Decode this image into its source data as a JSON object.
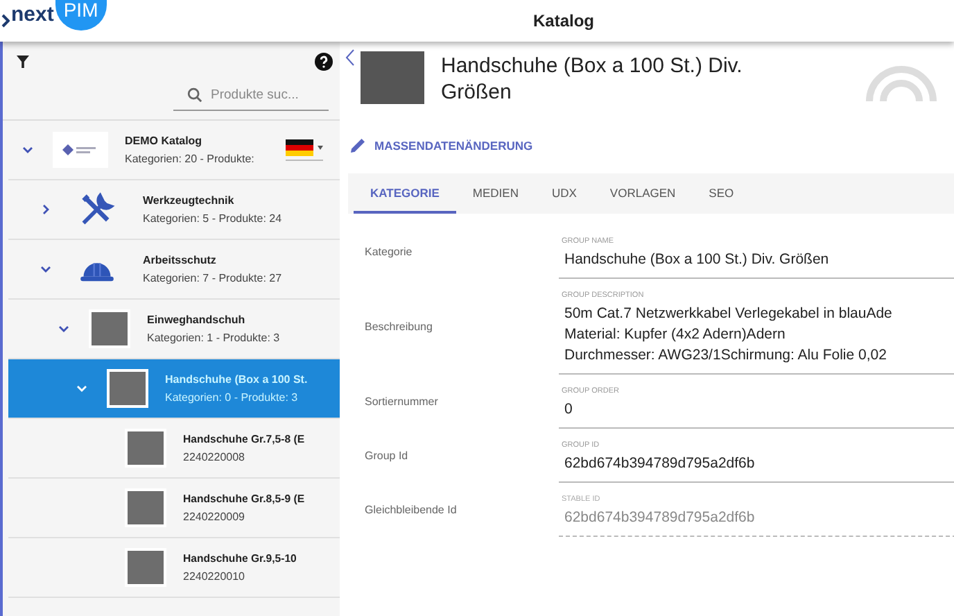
{
  "header": {
    "logo": {
      "prefix": "next",
      "suffix": "PIM"
    },
    "title": "Katalog"
  },
  "sidebar": {
    "search": {
      "placeholder": "Produkte suc..."
    },
    "tree": [
      {
        "kind": "catalog",
        "title": "DEMO Katalog",
        "subtitle": "Kategorien: 20 - Produkte:",
        "expanded": true,
        "selected": false,
        "children": [
          {
            "kind": "category",
            "title": "Werkzeugtechnik",
            "subtitle": "Kategorien: 5 - Produkte: 24",
            "expanded": false,
            "selected": false
          },
          {
            "kind": "category",
            "title": "Arbeitsschutz",
            "subtitle": "Kategorien: 7 - Produkte: 27",
            "expanded": true,
            "selected": false,
            "children": [
              {
                "kind": "category",
                "title": "Einweghandschuh",
                "subtitle": "Kategorien: 1 - Produkte: 3",
                "expanded": true,
                "selected": false,
                "children": [
                  {
                    "kind": "category",
                    "title": "Handschuhe (Box a 100 St.",
                    "subtitle": "Kategorien: 0 - Produkte: 3",
                    "expanded": true,
                    "selected": true,
                    "children": [
                      {
                        "kind": "product",
                        "title": "Handschuhe Gr.7,5-8 (E",
                        "subtitle": "2240220008",
                        "selected": false
                      },
                      {
                        "kind": "product",
                        "title": "Handschuhe Gr.8,5-9 (E",
                        "subtitle": "2240220009",
                        "selected": false
                      },
                      {
                        "kind": "product",
                        "title": "Handschuhe Gr.9,5-10",
                        "subtitle": "2240220010",
                        "selected": false
                      }
                    ]
                  }
                ]
              }
            ]
          }
        ]
      }
    ]
  },
  "detail": {
    "title": "Handschuhe (Box a 100 St.) Div. Größen",
    "mass_edit_button": "MASSENDATENÄNDERUNG",
    "tabs": [
      {
        "label": "KATEGORIE",
        "selected": true
      },
      {
        "label": "MEDIEN",
        "selected": false
      },
      {
        "label": "UDX",
        "selected": false
      },
      {
        "label": "VORLAGEN",
        "selected": false
      },
      {
        "label": "SEO",
        "selected": false
      }
    ],
    "fields": [
      {
        "label": "Kategorie",
        "caption": "GROUP NAME",
        "lines": [
          "Handschuhe (Box a 100 St.) Div. Größen"
        ],
        "disabled": false
      },
      {
        "label": "Beschreibung",
        "caption": "GROUP DESCRIPTION",
        "lines": [
          "50m Cat.7 Netzwerkkabel Verlegekabel in blauAde",
          "Material: Kupfer (4x2 Adern)Adern",
          "Durchmesser: AWG23/1Schirmung: Alu Folie 0,02"
        ],
        "disabled": false
      },
      {
        "label": "Sortiernummer",
        "caption": "GROUP ORDER",
        "lines": [
          "0"
        ],
        "disabled": false
      },
      {
        "label": "Group Id",
        "caption": "GROUP ID",
        "lines": [
          "62bd674b394789d795a2df6b"
        ],
        "disabled": false
      },
      {
        "label": "Gleichbleibende Id",
        "caption": "STABLE ID",
        "lines": [
          "62bd674b394789d795a2df6b"
        ],
        "disabled": true
      }
    ]
  }
}
